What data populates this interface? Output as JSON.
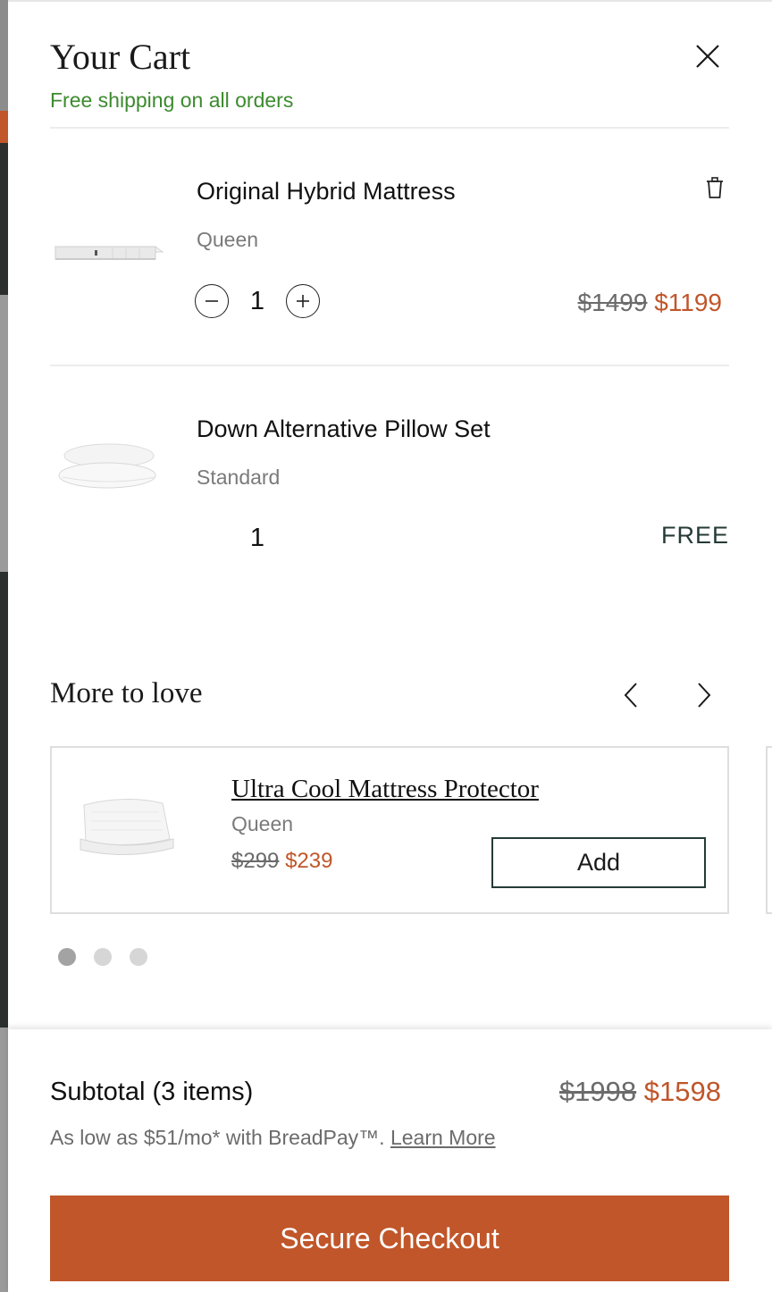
{
  "header": {
    "title": "Your Cart",
    "shipping_note": "Free shipping on all orders",
    "close_icon": "close-icon"
  },
  "cart_items": [
    {
      "name": "Original Hybrid Mattress",
      "variant": "Queen",
      "quantity": "1",
      "price_original": "$1499",
      "price_sale": "$1199",
      "thumbnail_icon": "mattress-image",
      "remove_icon": "trash-icon"
    },
    {
      "name": "Down Alternative Pillow Set",
      "variant": "Standard",
      "quantity": "1",
      "price_label": "FREE",
      "thumbnail_icon": "pillow-image"
    }
  ],
  "recommendations": {
    "title": "More to love",
    "items": [
      {
        "name": "Ultra Cool Mattress Protector",
        "variant": "Queen",
        "price_original": "$299",
        "price_sale": "$239",
        "add_label": "Add",
        "thumbnail_icon": "mattress-protector-image"
      }
    ],
    "page_count": 3,
    "active_page": 1
  },
  "summary": {
    "subtotal_label": "Subtotal (3 items)",
    "subtotal_original": "$1998",
    "subtotal_sale": "$1598",
    "finance_text": "As low as $51/mo* with BreadPay™.",
    "finance_link": "Learn More",
    "checkout_label": "Secure Checkout"
  },
  "colors": {
    "accent": "#c0562a",
    "shipping_green": "#3c8a2e",
    "dark_teal": "#253a36"
  }
}
